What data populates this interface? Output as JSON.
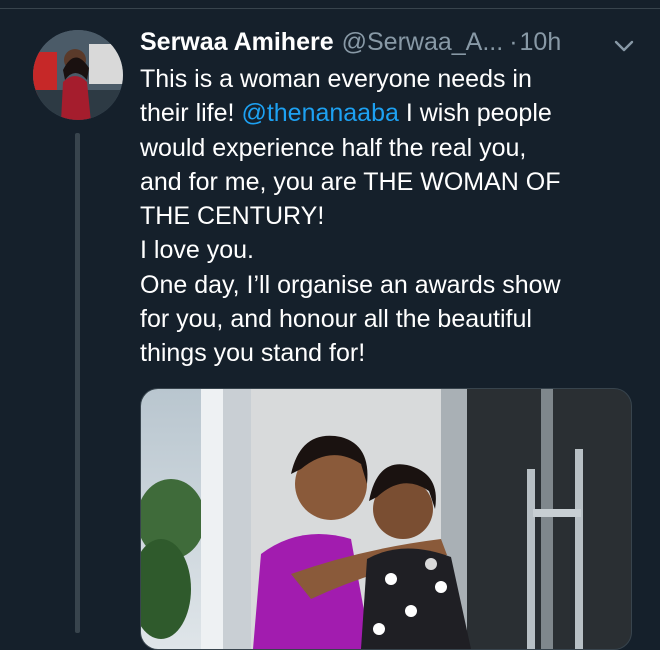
{
  "tweet": {
    "display_name": "Serwaa Amihere",
    "handle": "@Serwaa_A...",
    "separator": "·",
    "time": "10h",
    "mention": "@thenanaaba",
    "lines": {
      "l1": "This is a woman everyone needs in",
      "l2_before": "their life! ",
      "l2_after": " I wish people",
      "l3": "would experience half the real you,",
      "l4": "and for me, you are THE WOMAN OF",
      "l5": "THE CENTURY!",
      "l6": "I love you.",
      "l7": "One day, I’ll organise an awards show",
      "l8": "for you, and honour all the beautiful",
      "l9": "things you stand for!"
    }
  },
  "icons": {
    "caret": "chevron-down-icon"
  },
  "colors": {
    "background": "#15202b",
    "secondary_text": "#8899a6",
    "mention": "#1da1f2",
    "divider": "#38444d"
  }
}
